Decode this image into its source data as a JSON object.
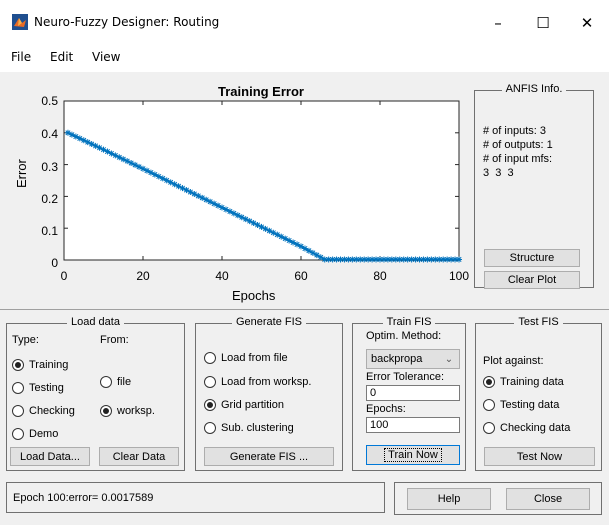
{
  "window": {
    "title": "Neuro-Fuzzy Designer: Routing",
    "controls": {
      "minimize": "–",
      "maximize": "☐",
      "close": "✕"
    }
  },
  "menu": [
    "File",
    "Edit",
    "View"
  ],
  "chart_data": {
    "type": "line",
    "title": "Training Error",
    "xlabel": "Epochs",
    "ylabel": "Error",
    "xlim": [
      0,
      100
    ],
    "ylim": [
      0,
      0.5
    ],
    "xticks": [
      "0",
      "20",
      "40",
      "60",
      "80",
      "100"
    ],
    "yticks": [
      "0",
      "0.1",
      "0.2",
      "0.3",
      "0.4",
      "0.5"
    ],
    "marker": "asterisk",
    "color": "#0072bd",
    "series": [
      {
        "x": [
          1,
          10,
          20,
          30,
          40,
          50,
          60,
          66,
          67,
          80,
          90,
          100
        ],
        "y": [
          0.4,
          0.347,
          0.287,
          0.226,
          0.165,
          0.104,
          0.043,
          0.0017589,
          0.0017589,
          0.0017589,
          0.0017589,
          0.0017589
        ]
      }
    ]
  },
  "anfis_info": {
    "title": "ANFIS Info.",
    "lines": [
      "# of inputs: 3",
      "# of outputs: 1",
      "# of input mfs:",
      "3  3  3"
    ],
    "structure_btn": "Structure",
    "clear_plot_btn": "Clear Plot"
  },
  "load_data": {
    "title": "Load data",
    "type_label": "Type:",
    "from_label": "From:",
    "types": [
      {
        "label": "Training",
        "selected": true
      },
      {
        "label": "Testing",
        "selected": false
      },
      {
        "label": "Checking",
        "selected": false
      },
      {
        "label": "Demo",
        "selected": false
      }
    ],
    "sources": [
      {
        "label": "file",
        "selected": false
      },
      {
        "label": "worksp.",
        "selected": true
      }
    ],
    "load_btn": "Load Data...",
    "clear_btn": "Clear Data"
  },
  "generate_fis": {
    "title": "Generate FIS",
    "options": [
      {
        "label": "Load from file",
        "selected": false
      },
      {
        "label": "Load from worksp.",
        "selected": false
      },
      {
        "label": "Grid partition",
        "selected": true
      },
      {
        "label": "Sub. clustering",
        "selected": false
      }
    ],
    "button": "Generate FIS ..."
  },
  "train_fis": {
    "title": "Train FIS",
    "optim_label": "Optim. Method:",
    "optim_value": "backpropa",
    "tolerance_label": "Error Tolerance:",
    "tolerance_value": "0",
    "epochs_label": "Epochs:",
    "epochs_value": "100",
    "button": "Train Now"
  },
  "test_fis": {
    "title": "Test FIS",
    "plot_against_label": "Plot against:",
    "options": [
      {
        "label": "Training data",
        "selected": true
      },
      {
        "label": "Testing data",
        "selected": false
      },
      {
        "label": "Checking data",
        "selected": false
      }
    ],
    "button": "Test Now"
  },
  "status": "Epoch 100:error= 0.0017589",
  "help_btn": "Help",
  "close_btn": "Close"
}
